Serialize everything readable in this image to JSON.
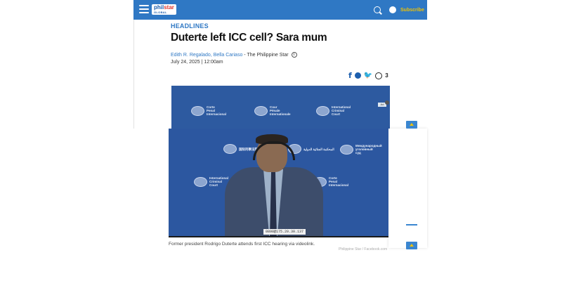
{
  "header": {
    "logo_main": "phil",
    "logo_accent": "star",
    "logo_sub": "GLOBAL",
    "subscribe_label": "Subscribe",
    "icons": [
      "hamburger-menu-icon",
      "search-icon",
      "user-icon"
    ],
    "colors": {
      "bar": "#2f78c4",
      "subscribe": "#f2c200"
    }
  },
  "article": {
    "kicker": "HEADLINES",
    "title": "Duterte left ICC cell? Sara mum",
    "authors": "Edith R. Regalado, Bella Cariaso",
    "publication": " - The Philippine Star",
    "date": "July 24, 2025 | 12:00am",
    "comment_count": "3"
  },
  "video_top": {
    "logos": [
      {
        "text": "Corte\nPenal\nInternacional"
      },
      {
        "text": "Cour\nPénale\nInternationale"
      },
      {
        "text": "International\nCriminal\nCourt"
      }
    ]
  },
  "video_main": {
    "logos": [
      {
        "text": "国际刑事法院"
      },
      {
        "text": "المحكمة الجنائية الدولية"
      },
      {
        "text": "Международный\nуголовный\nсуд"
      },
      {
        "text": "International\nCriminal\nCourt"
      },
      {
        "text": "Corte\nPenal\nInternacional"
      }
    ],
    "timecode": "0898@175.20.30.137"
  },
  "caption": "Former president Rodrigo Duterte attends first ICC hearing via videolink.",
  "credit": "Philippine Star / Facebook.com"
}
